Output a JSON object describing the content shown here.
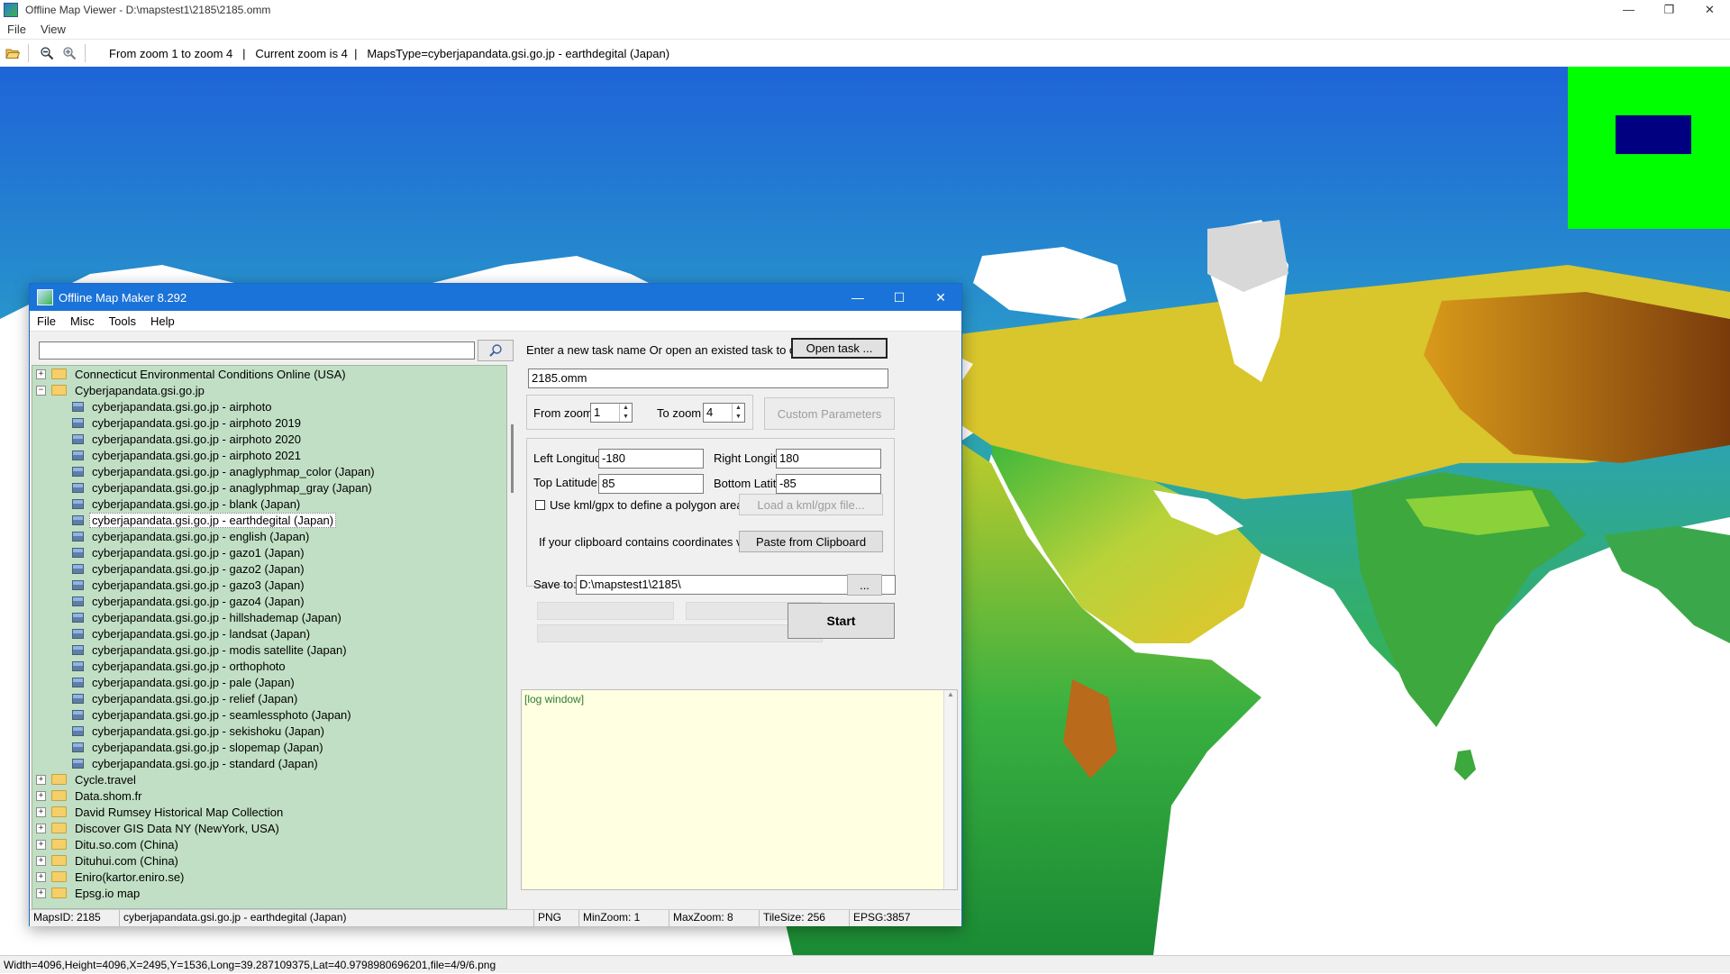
{
  "viewer": {
    "title": "Offline Map Viewer - D:\\mapstest1\\2185\\2185.omm",
    "window_controls": [
      "—",
      "❐",
      "✕"
    ],
    "menu": [
      "File",
      "View"
    ],
    "toolbar": {
      "open_icon": "folder-open-icon",
      "zoom_out_icon": "zoom-out-icon",
      "zoom_in_icon": "zoom-in-icon",
      "info": "From zoom 1 to zoom 4   |   Current zoom is 4  |   MapsType=cyberjapandata.gsi.go.jp - earthdegital (Japan)"
    },
    "minimap": {
      "background": "#00ff00",
      "viewport_color": "#000080"
    },
    "status": "Width=4096,Height=4096,X=2495,Y=1536,Long=39.287109375,Lat=40.9798980696201,file=4/9/6.png"
  },
  "map_colors": {
    "ocean": "#ffffff",
    "low": "#1f5fd6",
    "green": "#2fae3b",
    "yellow": "#e8d21f",
    "brown": "#8b4a10",
    "ice": "#d8d8d8"
  },
  "dialog": {
    "title": "Offline Map Maker 8.292",
    "window_controls": [
      "—",
      "☐",
      "✕"
    ],
    "menu": [
      "File",
      "Misc",
      "Tools",
      "Help"
    ],
    "search": {
      "value": "",
      "placeholder": "",
      "button_icon": "search-icon"
    },
    "tree": {
      "items": [
        {
          "level": 0,
          "expander": "+",
          "label": "Connecticut Environmental Conditions Online (USA)"
        },
        {
          "level": 0,
          "expander": "−",
          "label": "Cyberjapandata.gsi.go.jp",
          "open": true
        },
        {
          "level": 1,
          "label": "cyberjapandata.gsi.go.jp - airphoto"
        },
        {
          "level": 1,
          "label": "cyberjapandata.gsi.go.jp - airphoto 2019"
        },
        {
          "level": 1,
          "label": "cyberjapandata.gsi.go.jp - airphoto 2020"
        },
        {
          "level": 1,
          "label": "cyberjapandata.gsi.go.jp - airphoto 2021"
        },
        {
          "level": 1,
          "label": "cyberjapandata.gsi.go.jp - anaglyphmap_color (Japan)"
        },
        {
          "level": 1,
          "label": "cyberjapandata.gsi.go.jp - anaglyphmap_gray (Japan)"
        },
        {
          "level": 1,
          "label": "cyberjapandata.gsi.go.jp - blank (Japan)"
        },
        {
          "level": 1,
          "label": "cyberjapandata.gsi.go.jp - earthdegital (Japan)",
          "selected": true
        },
        {
          "level": 1,
          "label": "cyberjapandata.gsi.go.jp - english (Japan)"
        },
        {
          "level": 1,
          "label": "cyberjapandata.gsi.go.jp - gazo1 (Japan)"
        },
        {
          "level": 1,
          "label": "cyberjapandata.gsi.go.jp - gazo2 (Japan)"
        },
        {
          "level": 1,
          "label": "cyberjapandata.gsi.go.jp - gazo3 (Japan)"
        },
        {
          "level": 1,
          "label": "cyberjapandata.gsi.go.jp - gazo4 (Japan)"
        },
        {
          "level": 1,
          "label": "cyberjapandata.gsi.go.jp - hillshademap (Japan)"
        },
        {
          "level": 1,
          "label": "cyberjapandata.gsi.go.jp - landsat (Japan)"
        },
        {
          "level": 1,
          "label": "cyberjapandata.gsi.go.jp - modis satellite (Japan)"
        },
        {
          "level": 1,
          "label": "cyberjapandata.gsi.go.jp - orthophoto"
        },
        {
          "level": 1,
          "label": "cyberjapandata.gsi.go.jp - pale (Japan)"
        },
        {
          "level": 1,
          "label": "cyberjapandata.gsi.go.jp - relief (Japan)"
        },
        {
          "level": 1,
          "label": "cyberjapandata.gsi.go.jp - seamlessphoto (Japan)"
        },
        {
          "level": 1,
          "label": "cyberjapandata.gsi.go.jp - sekishoku (Japan)"
        },
        {
          "level": 1,
          "label": "cyberjapandata.gsi.go.jp - slopemap (Japan)"
        },
        {
          "level": 1,
          "label": "cyberjapandata.gsi.go.jp - standard (Japan)"
        },
        {
          "level": 0,
          "expander": "+",
          "label": "Cycle.travel"
        },
        {
          "level": 0,
          "expander": "+",
          "label": "Data.shom.fr"
        },
        {
          "level": 0,
          "expander": "+",
          "label": "David Rumsey Historical Map Collection"
        },
        {
          "level": 0,
          "expander": "+",
          "label": "Discover GIS Data NY (NewYork, USA)"
        },
        {
          "level": 0,
          "expander": "+",
          "label": "Ditu.so.com (China)"
        },
        {
          "level": 0,
          "expander": "+",
          "label": "Dituhui.com (China)"
        },
        {
          "level": 0,
          "expander": "+",
          "label": "Eniro(kartor.eniro.se)"
        },
        {
          "level": 0,
          "expander": "+",
          "label": "Epsg.io map"
        }
      ]
    },
    "task": {
      "prompt": "Enter a new task name Or open an existed task to continue:",
      "open_button": "Open task ...",
      "name_value": "2185.omm"
    },
    "zoom": {
      "from_label": "From zoom",
      "from_value": "1",
      "to_label": "To zoom",
      "to_value": "4",
      "custom_button": "Custom Parameters"
    },
    "bounds": {
      "left_label": "Left Longitude",
      "left_value": "-180",
      "right_label": "Right Longitude",
      "right_value": "180",
      "top_label": "Top Latitude",
      "top_value": "85",
      "bottom_label": "Bottom Latitude",
      "bottom_value": "-85",
      "kml_checkbox_label": "Use kml/gpx to define a polygon area",
      "kml_checked": false,
      "kml_button": "Load a kml/gpx file...",
      "clipboard_label": "If your clipboard contains coordinates values:",
      "clipboard_button": "Paste from Clipboard"
    },
    "save": {
      "label": "Save to:",
      "value": "D:\\mapstest1\\2185\\",
      "browse_button": "..."
    },
    "start_button": "Start",
    "log": {
      "text": "[log window]"
    },
    "status": {
      "maps_id": "MapsID: 2185",
      "maps_name": "cyberjapandata.gsi.go.jp - earthdegital (Japan)",
      "format": "PNG",
      "min_zoom": "MinZoom: 1",
      "max_zoom": "MaxZoom: 8",
      "tile_size": "TileSize: 256",
      "epsg": "EPSG:3857"
    }
  }
}
